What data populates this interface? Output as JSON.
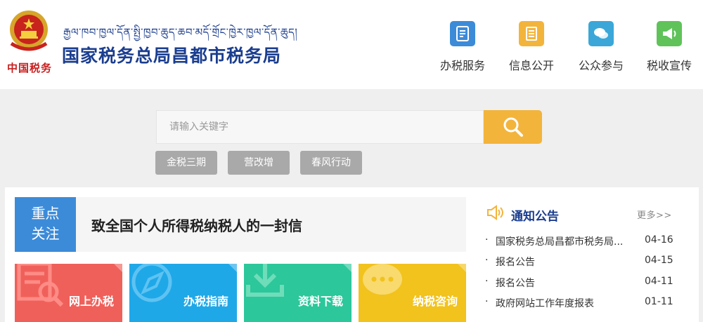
{
  "header": {
    "emblem_text": "中国税务",
    "tibetan_title": "རྒྱལ་ཁབ་ཁྱལ་དོན་སྤྱི་ཁྱབ་ཆུད་ཆབ་མདོ་གྲོང་ཁྱེར་ཁྱལ་དོན་ཆུད།",
    "title": "国家税务总局昌都市税务局"
  },
  "nav": [
    {
      "label": "办税服务",
      "icon": "tax-service-icon",
      "color": "#3c8bd9"
    },
    {
      "label": "信息公开",
      "icon": "document-list-icon",
      "color": "#f3b43c"
    },
    {
      "label": "公众参与",
      "icon": "chat-bubbles-icon",
      "color": "#3aa7d8"
    },
    {
      "label": "税收宣传",
      "icon": "megaphone-icon",
      "color": "#5fc35a"
    }
  ],
  "search": {
    "placeholder": "请输入关键字",
    "button_icon": "search-icon",
    "hot_tags": [
      "金税三期",
      "营改增",
      "春风行动"
    ]
  },
  "focus": {
    "label_line1": "重点",
    "label_line2": "关注",
    "headline": "致全国个人所得税纳税人的一封信"
  },
  "tiles": [
    {
      "label": "网上办税",
      "color": "#f0605a",
      "icon": "online-tax-icon"
    },
    {
      "label": "办税指南",
      "color": "#1fa8e8",
      "icon": "compass-icon"
    },
    {
      "label": "资料下载",
      "color": "#2cc79b",
      "icon": "download-icon"
    },
    {
      "label": "纳税咨询",
      "color": "#f2c21d",
      "icon": "consult-chat-icon"
    }
  ],
  "notices": {
    "title": "通知公告",
    "more": "更多>>",
    "items": [
      {
        "text": "国家税务总局昌都市税务局...",
        "date": "04-16"
      },
      {
        "text": "报名公告",
        "date": "04-15"
      },
      {
        "text": "报名公告",
        "date": "04-11"
      },
      {
        "text": "政府网站工作年度报表",
        "date": "01-11"
      }
    ]
  }
}
